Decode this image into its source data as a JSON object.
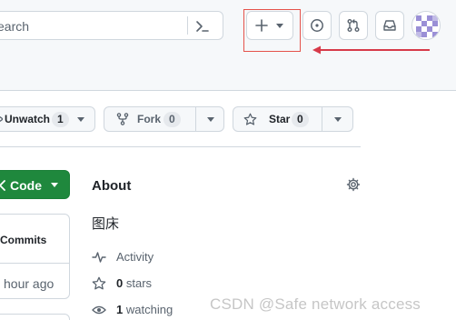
{
  "header": {
    "search_placeholder": "earch",
    "icons": [
      "command-palette-icon",
      "plus-icon",
      "issues-icon",
      "pull-requests-icon",
      "inbox-icon"
    ]
  },
  "annotation": {
    "box_color": "#e5534b",
    "arrow_color": "#d73a49"
  },
  "repo_actions": {
    "watch": {
      "label": "Unwatch",
      "count": "1"
    },
    "fork": {
      "label": "Fork",
      "count": "0"
    },
    "star": {
      "label": "Star",
      "count": "0"
    }
  },
  "code_button": {
    "label": "Code",
    "color": "#1f883d"
  },
  "commits_box": {
    "label": "Commits",
    "time": "hour ago"
  },
  "about": {
    "title": "About",
    "description": "图床",
    "activity": "Activity",
    "stars_count": "0",
    "stars_label": "stars",
    "watching_count": "1",
    "watching_label": "watching"
  },
  "watermark": "CSDN @Safe network access"
}
